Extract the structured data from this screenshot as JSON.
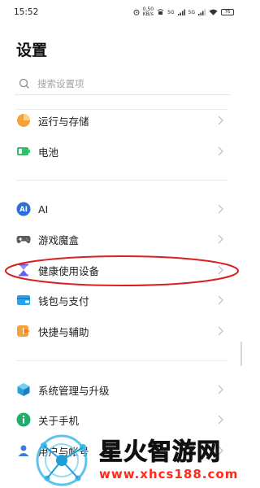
{
  "status_bar": {
    "time": "15:52",
    "net_speed": "0.50\nKB/s",
    "signal1": "5G",
    "signal2": "5G",
    "battery": "76"
  },
  "title": "设置",
  "search": {
    "placeholder": "搜索设置项"
  },
  "items": [
    {
      "label": "运行与存储",
      "icon": "storage-pie-icon"
    },
    {
      "label": "电池",
      "icon": "battery-icon"
    },
    {
      "label": "AI",
      "icon": "ai-icon"
    },
    {
      "label": "游戏魔盒",
      "icon": "gamepad-icon"
    },
    {
      "label": "健康使用设备",
      "icon": "hourglass-icon"
    },
    {
      "label": "钱包与支付",
      "icon": "wallet-icon"
    },
    {
      "label": "快捷与辅助",
      "icon": "shortcut-icon"
    },
    {
      "label": "系统管理与升级",
      "icon": "system-cube-icon"
    },
    {
      "label": "关于手机",
      "icon": "info-icon"
    },
    {
      "label": "用户与帐号",
      "icon": "user-icon"
    }
  ],
  "watermark": {
    "title": "星火智游网",
    "url": "www.xhcs188.com"
  },
  "colors": {
    "accent_orange": "#f2a33a",
    "accent_green": "#2fbf6d",
    "accent_blue": "#2a6fdb",
    "accent_purple": "#6b5cf0",
    "annotation_red": "#d91f1f",
    "watermark_red": "#ff2a1a"
  }
}
